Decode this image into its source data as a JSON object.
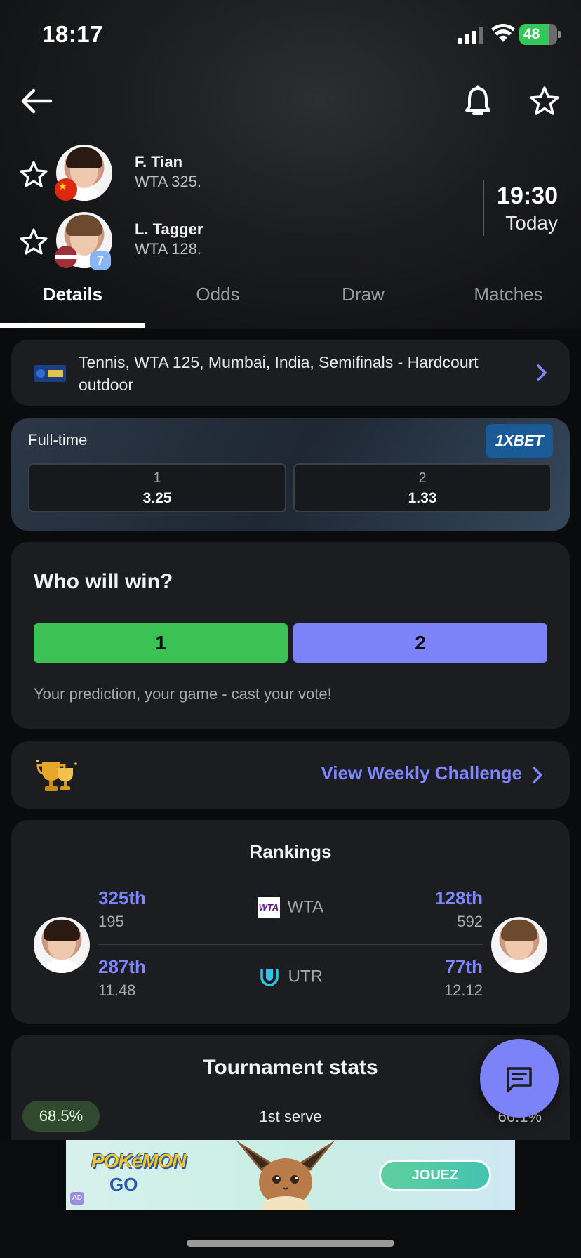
{
  "status_bar": {
    "time": "18:17",
    "battery": "48"
  },
  "match": {
    "home": {
      "name": "F. Tian",
      "rank": "WTA 325."
    },
    "away": {
      "name": "L. Tagger",
      "rank": "WTA 128.",
      "seed": "7"
    },
    "start_time": "19:30",
    "start_day": "Today"
  },
  "tabs": [
    "Details",
    "Odds",
    "Draw",
    "Matches"
  ],
  "tournament": {
    "label": "Tennis, WTA 125, Mumbai, India, Semifinals - Hardcourt outdoor"
  },
  "odds": {
    "title": "Full-time",
    "provider": "1XBET",
    "options": [
      {
        "label": "1",
        "value": "3.25"
      },
      {
        "label": "2",
        "value": "1.33"
      }
    ]
  },
  "vote": {
    "title": "Who will win?",
    "option1": "1",
    "option2": "2",
    "hint": "Your prediction, your game - cast your vote!"
  },
  "challenge": {
    "link": "View Weekly Challenge"
  },
  "rankings": {
    "title": "Rankings",
    "rows": [
      {
        "org": "WTA",
        "left_pos": "325th",
        "left_val": "195",
        "right_pos": "128th",
        "right_val": "592"
      },
      {
        "org": "UTR",
        "left_pos": "287th",
        "left_val": "11.48",
        "right_pos": "77th",
        "right_val": "12.12"
      }
    ]
  },
  "tournament_stats": {
    "title": "Tournament stats",
    "first_row": {
      "left": "68.5%",
      "label": "1st serve",
      "right": "66.1%"
    }
  },
  "ad": {
    "brand_top": "POKéMON",
    "brand_bottom": "GO",
    "cta": "JOUEZ",
    "badge": "AD"
  },
  "colors": {
    "accent": "#7c82f8",
    "vote_home": "#3cc154",
    "vote_away": "#7c82f8",
    "battery": "#34c759"
  }
}
